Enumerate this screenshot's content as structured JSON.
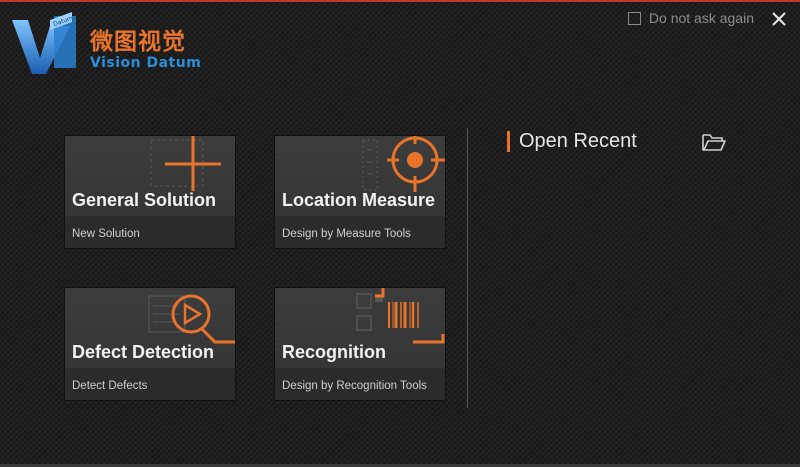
{
  "app": {
    "logo_cn": "微图视觉",
    "logo_en": "Vision Datum",
    "logo_mark_text": "Datum"
  },
  "header": {
    "do_not_ask_label": "Do not ask again",
    "close_icon": "close-icon"
  },
  "tiles": [
    {
      "title": "General Solution",
      "subtitle": "New Solution",
      "icon": "crosshair-icon"
    },
    {
      "title": "Location Measure",
      "subtitle": "Design by Measure Tools",
      "icon": "target-icon"
    },
    {
      "title": "Defect Detection",
      "subtitle": "Detect Defects",
      "icon": "play-detect-icon"
    },
    {
      "title": "Recognition",
      "subtitle": "Design by Recognition Tools",
      "icon": "barcode-icon"
    }
  ],
  "recent": {
    "label": "Open Recent",
    "folder_icon": "folder-open-icon"
  },
  "colors": {
    "accent": "#e8742c",
    "brand_blue": "#2a8fd8",
    "background": "#1f1f1f"
  }
}
